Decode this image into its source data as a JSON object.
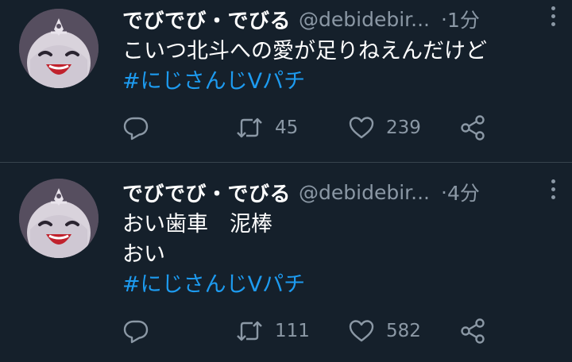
{
  "colors": {
    "background": "#15202b",
    "divider": "#38444d",
    "secondary_text": "#8b98a5",
    "hashtag": "#1d9bf0"
  },
  "tweets": [
    {
      "display_name": "でびでび・でびる",
      "handle": "@debidebir...",
      "separator": "·",
      "time": "1分",
      "lines": [
        "こいつ北斗への愛が足りねえんだけど"
      ],
      "hashtag": "#にじさんじVパチ",
      "retweets": "45",
      "likes": "239",
      "icons": [
        "reply-icon",
        "retweet-icon",
        "like-icon",
        "share-icon",
        "more-icon"
      ]
    },
    {
      "display_name": "でびでび・でびる",
      "handle": "@debidebir...",
      "separator": "·",
      "time": "4分",
      "lines": [
        "おい歯車　泥棒",
        "おい"
      ],
      "hashtag": "#にじさんじVパチ",
      "retweets": "111",
      "likes": "582",
      "icons": [
        "reply-icon",
        "retweet-icon",
        "like-icon",
        "share-icon",
        "more-icon"
      ]
    }
  ]
}
